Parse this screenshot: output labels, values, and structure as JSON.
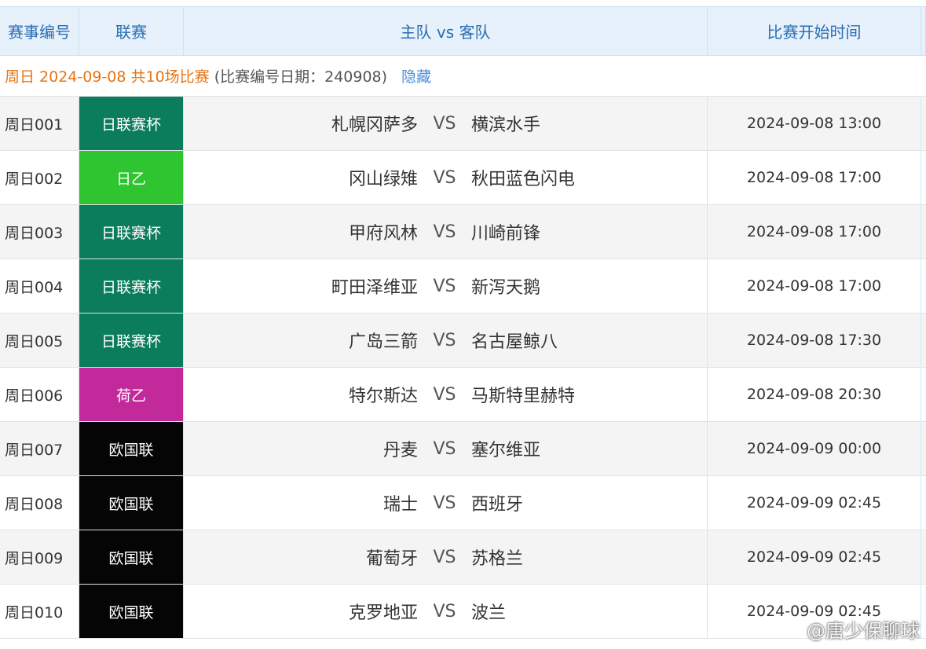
{
  "header": {
    "col_id": "赛事编号",
    "col_league": "联赛",
    "col_match": "主队 vs 客队",
    "col_time": "比赛开始时间"
  },
  "dateline": {
    "date_text": "周日 2024-09-08 共10场比赛",
    "note_text": "(比赛编号日期：240908)",
    "hide_link": "隐藏"
  },
  "vs_label": "VS",
  "colors": {
    "日联赛杯": "#0c7d5c",
    "日乙": "#2ec531",
    "荷乙": "#c22a9b",
    "欧国联": "#050505"
  },
  "matches": [
    {
      "id": "周日001",
      "league": "日联赛杯",
      "home": "札幌冈萨多",
      "away": "横滨水手",
      "time": "2024-09-08 13:00"
    },
    {
      "id": "周日002",
      "league": "日乙",
      "home": "冈山绿雉",
      "away": "秋田蓝色闪电",
      "time": "2024-09-08 17:00"
    },
    {
      "id": "周日003",
      "league": "日联赛杯",
      "home": "甲府风林",
      "away": "川崎前锋",
      "time": "2024-09-08 17:00"
    },
    {
      "id": "周日004",
      "league": "日联赛杯",
      "home": "町田泽维亚",
      "away": "新泻天鹅",
      "time": "2024-09-08 17:00"
    },
    {
      "id": "周日005",
      "league": "日联赛杯",
      "home": "广岛三箭",
      "away": "名古屋鲸八",
      "time": "2024-09-08 17:30"
    },
    {
      "id": "周日006",
      "league": "荷乙",
      "home": "特尔斯达",
      "away": "马斯特里赫特",
      "time": "2024-09-08 20:30"
    },
    {
      "id": "周日007",
      "league": "欧国联",
      "home": "丹麦",
      "away": "塞尔维亚",
      "time": "2024-09-09 00:00"
    },
    {
      "id": "周日008",
      "league": "欧国联",
      "home": "瑞士",
      "away": "西班牙",
      "time": "2024-09-09 02:45"
    },
    {
      "id": "周日009",
      "league": "欧国联",
      "home": "葡萄牙",
      "away": "苏格兰",
      "time": "2024-09-09 02:45"
    },
    {
      "id": "周日010",
      "league": "欧国联",
      "home": "克罗地亚",
      "away": "波兰",
      "time": "2024-09-09 02:45"
    }
  ],
  "watermark": {
    "icon": "weibo-icon",
    "text": "@唐少保聊球"
  }
}
